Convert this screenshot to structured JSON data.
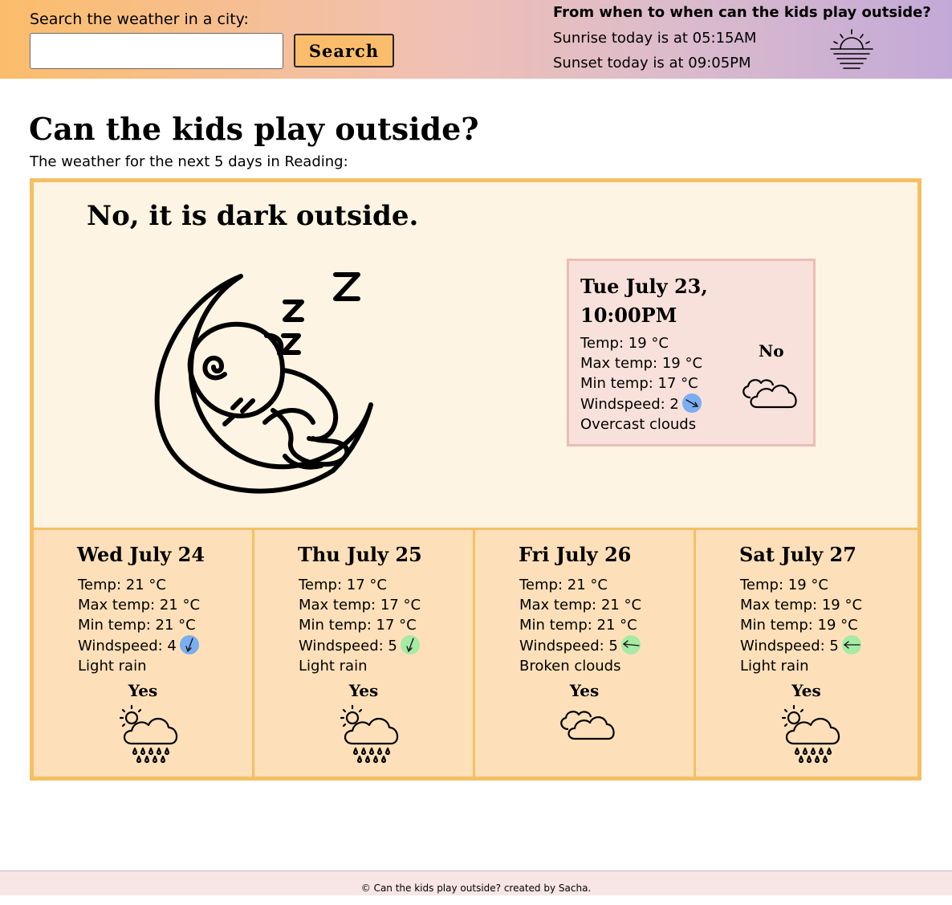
{
  "header": {
    "search_label": "Search the weather in a city:",
    "search_value": "",
    "search_button": "Search",
    "sun_title": "From when to when can the kids play outside?",
    "sunrise": "Sunrise today is at 05:15AM",
    "sunset": "Sunset today is at 09:05PM",
    "sun_icon": "sunset-icon"
  },
  "main": {
    "title": "Can the kids play outside?",
    "subtitle": "The weather for the next 5 days in Reading:",
    "verdict": "No, it is dark outside.",
    "illustration": "sleeping-baby-on-moon"
  },
  "current": {
    "date": "Tue July 23, 10:00PM",
    "temp": "Temp: 19 °C",
    "max": "Max temp: 19 °C",
    "min": "Min temp: 17 °C",
    "wind": "Windspeed: 2",
    "description": "Overcast clouds",
    "verdict": "No",
    "icon": "clouds-icon",
    "wind_color": "#7aaef0"
  },
  "days": [
    {
      "title": "Wed July 24",
      "temp": "Temp: 21 °C",
      "max": "Max temp: 21 °C",
      "min": "Min temp: 21 °C",
      "wind": "Windspeed: 4",
      "description": "Light rain",
      "verdict": "Yes",
      "icon": "rain-icon",
      "wind_color": "#7aaef0"
    },
    {
      "title": "Thu July 25",
      "temp": "Temp: 17 °C",
      "max": "Max temp: 17 °C",
      "min": "Min temp: 17 °C",
      "wind": "Windspeed: 5",
      "description": "Light rain",
      "verdict": "Yes",
      "icon": "rain-icon",
      "wind_color": "#a5eba5"
    },
    {
      "title": "Fri July 26",
      "temp": "Temp: 21 °C",
      "max": "Max temp: 21 °C",
      "min": "Min temp: 21 °C",
      "wind": "Windspeed: 5",
      "description": "Broken clouds",
      "verdict": "Yes",
      "icon": "clouds-icon",
      "wind_color": "#a5eba5"
    },
    {
      "title": "Sat July 27",
      "temp": "Temp: 19 °C",
      "max": "Max temp: 19 °C",
      "min": "Min temp: 19 °C",
      "wind": "Windspeed: 5",
      "description": "Light rain",
      "verdict": "Yes",
      "icon": "rain-icon",
      "wind_color": "#a5eba5"
    }
  ],
  "footer": {
    "text": "© Can the kids play outside? created by Sacha."
  },
  "colors": {
    "panel_border": "#f5bf64",
    "panel_bg": "#fef4e3",
    "forecast_bg": "#fde0b9",
    "current_card_bg": "#f8e1da"
  }
}
